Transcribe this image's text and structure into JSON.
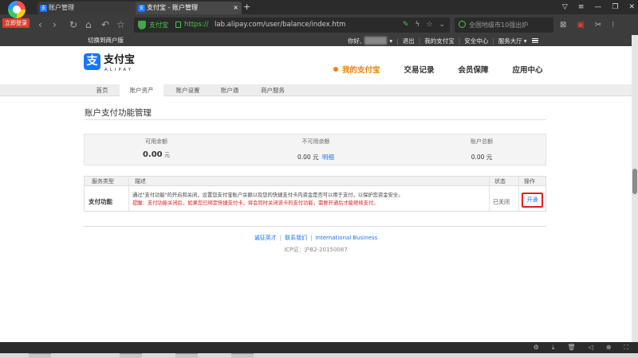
{
  "browser": {
    "login_badge": "立即登录",
    "tabs": [
      {
        "title": "账户管理",
        "close": "×"
      },
      {
        "title": "支付宝 - 账户管理",
        "close": "×"
      }
    ],
    "new_tab": "+",
    "address": {
      "site_label": "支付宝",
      "scheme": "https://",
      "rest": "lab.alipay.com/user/balance/index.htm"
    },
    "search_placeholder": "全国地级市10强出炉"
  },
  "topbar": {
    "switch_merchant": "切换到商户版",
    "greeting": "你好,",
    "logout": "退出",
    "my_alipay": "我的支付宝",
    "security_center": "安全中心",
    "service_hall": "服务大厅"
  },
  "header": {
    "brand_name": "支付宝",
    "brand_en": "ALIPAY",
    "brand_mark": "支",
    "nav": [
      {
        "label": "我的支付宝",
        "active": true
      },
      {
        "label": "交易记录",
        "active": false
      },
      {
        "label": "会员保障",
        "active": false
      },
      {
        "label": "应用中心",
        "active": false
      }
    ]
  },
  "subnav": [
    "首页",
    "账户资产",
    "账户设置",
    "账户通",
    "商户服务"
  ],
  "page": {
    "title": "账户支付功能管理",
    "balance": {
      "available_label": "可用余额",
      "available_value": "0.00",
      "available_unit": "元",
      "unavailable_label": "不可用余额",
      "unavailable_value": "0.00",
      "unavailable_unit": "元",
      "detail_link": "明细",
      "total_label": "账户总额",
      "total_value": "0.00",
      "total_unit": "元"
    },
    "table": {
      "headers": [
        "服务类型",
        "描述",
        "状态",
        "操作"
      ],
      "row": {
        "type": "支付功能",
        "description": "通过\"支付功能\"的开启和关闭，设置您支付宝账户余额以及您的快捷支付卡内资金是否可以用于支付，以保护您资金安全。",
        "warning": "提醒：支付功能关闭后，如果您已绑定快捷支付卡，将会同时关闭该卡的支付功能，需要开通后才能继续支付。",
        "status": "已关闭",
        "action": "开通"
      }
    }
  },
  "footer": {
    "links": [
      "诚征英才",
      "联系我们",
      "International Business"
    ],
    "icp": "ICP证：沪B2-20150087"
  },
  "colors": {
    "accent_orange": "#f08200",
    "link_blue": "#1677ff",
    "warning_red": "#e02020",
    "secure_green": "#46c946"
  }
}
